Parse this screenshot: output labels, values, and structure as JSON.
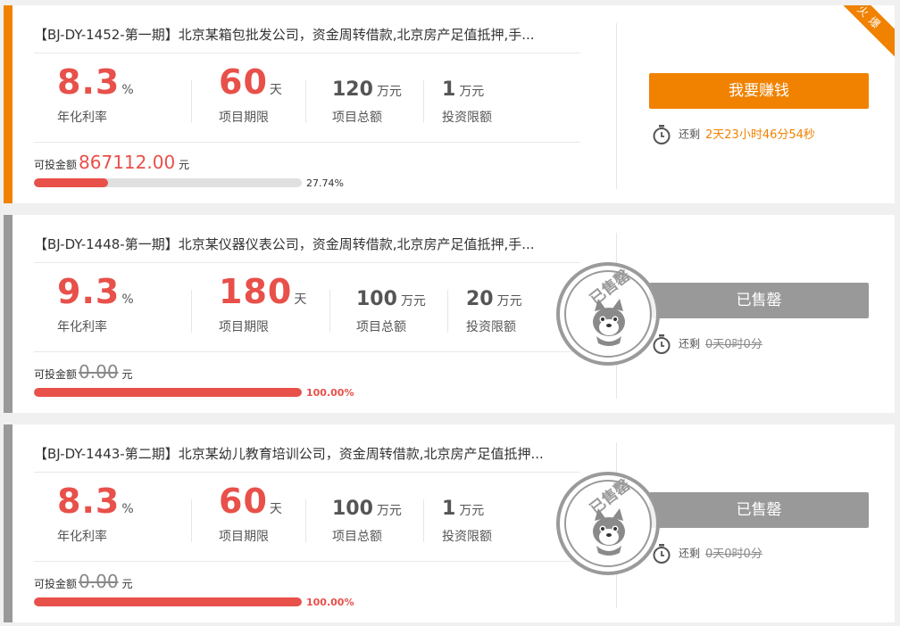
{
  "cards": [
    {
      "title": "【BJ-DY-1452-第一期】北京某箱包批发公司，资金周转借款,北京房产足值抵押,手...",
      "rate": "8.3",
      "rate_unit": "%",
      "rate_label": "年化利率",
      "term": "60",
      "term_unit": "天",
      "term_label": "项目期限",
      "total": "120",
      "total_unit": "万元",
      "total_label": "项目总额",
      "limit": "1",
      "limit_unit": "万元",
      "limit_label": "投资限额",
      "avail_label": "可投金额",
      "avail_value": "867112.00",
      "avail_unit": "元",
      "progress": 27.74,
      "progress_text": "27.74%",
      "button": "我要赚钱",
      "remain_label": "还剩",
      "remain_time": "2天23小时46分54秒",
      "badge": "火爆"
    },
    {
      "title": "【BJ-DY-1448-第一期】北京某仪器仪表公司，资金周转借款,北京房产足值抵押,手...",
      "rate": "9.3",
      "rate_unit": "%",
      "rate_label": "年化利率",
      "term": "180",
      "term_unit": "天",
      "term_label": "项目期限",
      "total": "100",
      "total_unit": "万元",
      "total_label": "项目总额",
      "limit": "20",
      "limit_unit": "万元",
      "limit_label": "投资限额",
      "avail_label": "可投金额",
      "avail_value": "0.00",
      "avail_unit": "元",
      "progress": 100,
      "progress_text": "100.00%",
      "button": "已售罄",
      "remain_label": "还剩",
      "remain_time": "0天0时0分",
      "stamp": "已售罄"
    },
    {
      "title": "【BJ-DY-1443-第二期】北京某幼儿教育培训公司，资金周转借款,北京房产足值抵押...",
      "rate": "8.3",
      "rate_unit": "%",
      "rate_label": "年化利率",
      "term": "60",
      "term_unit": "天",
      "term_label": "项目期限",
      "total": "100",
      "total_unit": "万元",
      "total_label": "项目总额",
      "limit": "1",
      "limit_unit": "万元",
      "limit_label": "投资限额",
      "avail_label": "可投金额",
      "avail_value": "0.00",
      "avail_unit": "元",
      "progress": 100,
      "progress_text": "100.00%",
      "button": "已售罄",
      "remain_label": "还剩",
      "remain_time": "0天0时0分",
      "stamp": "已售罄"
    }
  ],
  "colors": {
    "accent": "#f08200",
    "red": "#e8504a",
    "sold": "#999999"
  }
}
